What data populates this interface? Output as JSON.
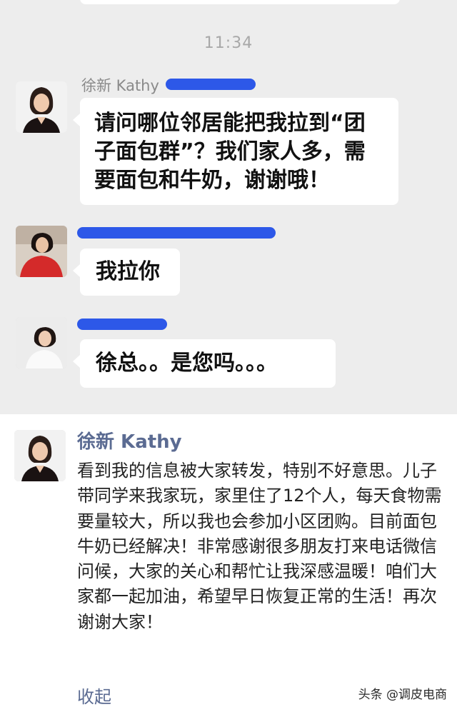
{
  "chat": {
    "time": "11:34",
    "messages": [
      {
        "sender": "徐新 Kathy",
        "text": "请问哪位邻居能把我拉到“团子面包群”？我们家人多，需要面包和牛奶，谢谢哦！"
      },
      {
        "sender": "",
        "text": "我拉你"
      },
      {
        "sender": "",
        "text": "徐总。。是您吗。。。"
      }
    ]
  },
  "post": {
    "author": "徐新 Kathy",
    "text": "看到我的信息被大家转发，特别不好意思。儿子带同学来我家玩，家里住了12个人，每天食物需要量较大，所以我也会参加小区团购。目前面包牛奶已经解决！非常感谢很多朋友打来电话微信问候，大家的关心和帮忙让我深感温暖！咱们大家都一起加油，希望早日恢复正常的生活！再次谢谢大家！",
    "collapse_label": "收起"
  },
  "watermark": "头条 @调皮电商",
  "colors": {
    "chat_bg": "#ededed",
    "redaction": "#2d58e8",
    "link": "#5b6b92"
  }
}
